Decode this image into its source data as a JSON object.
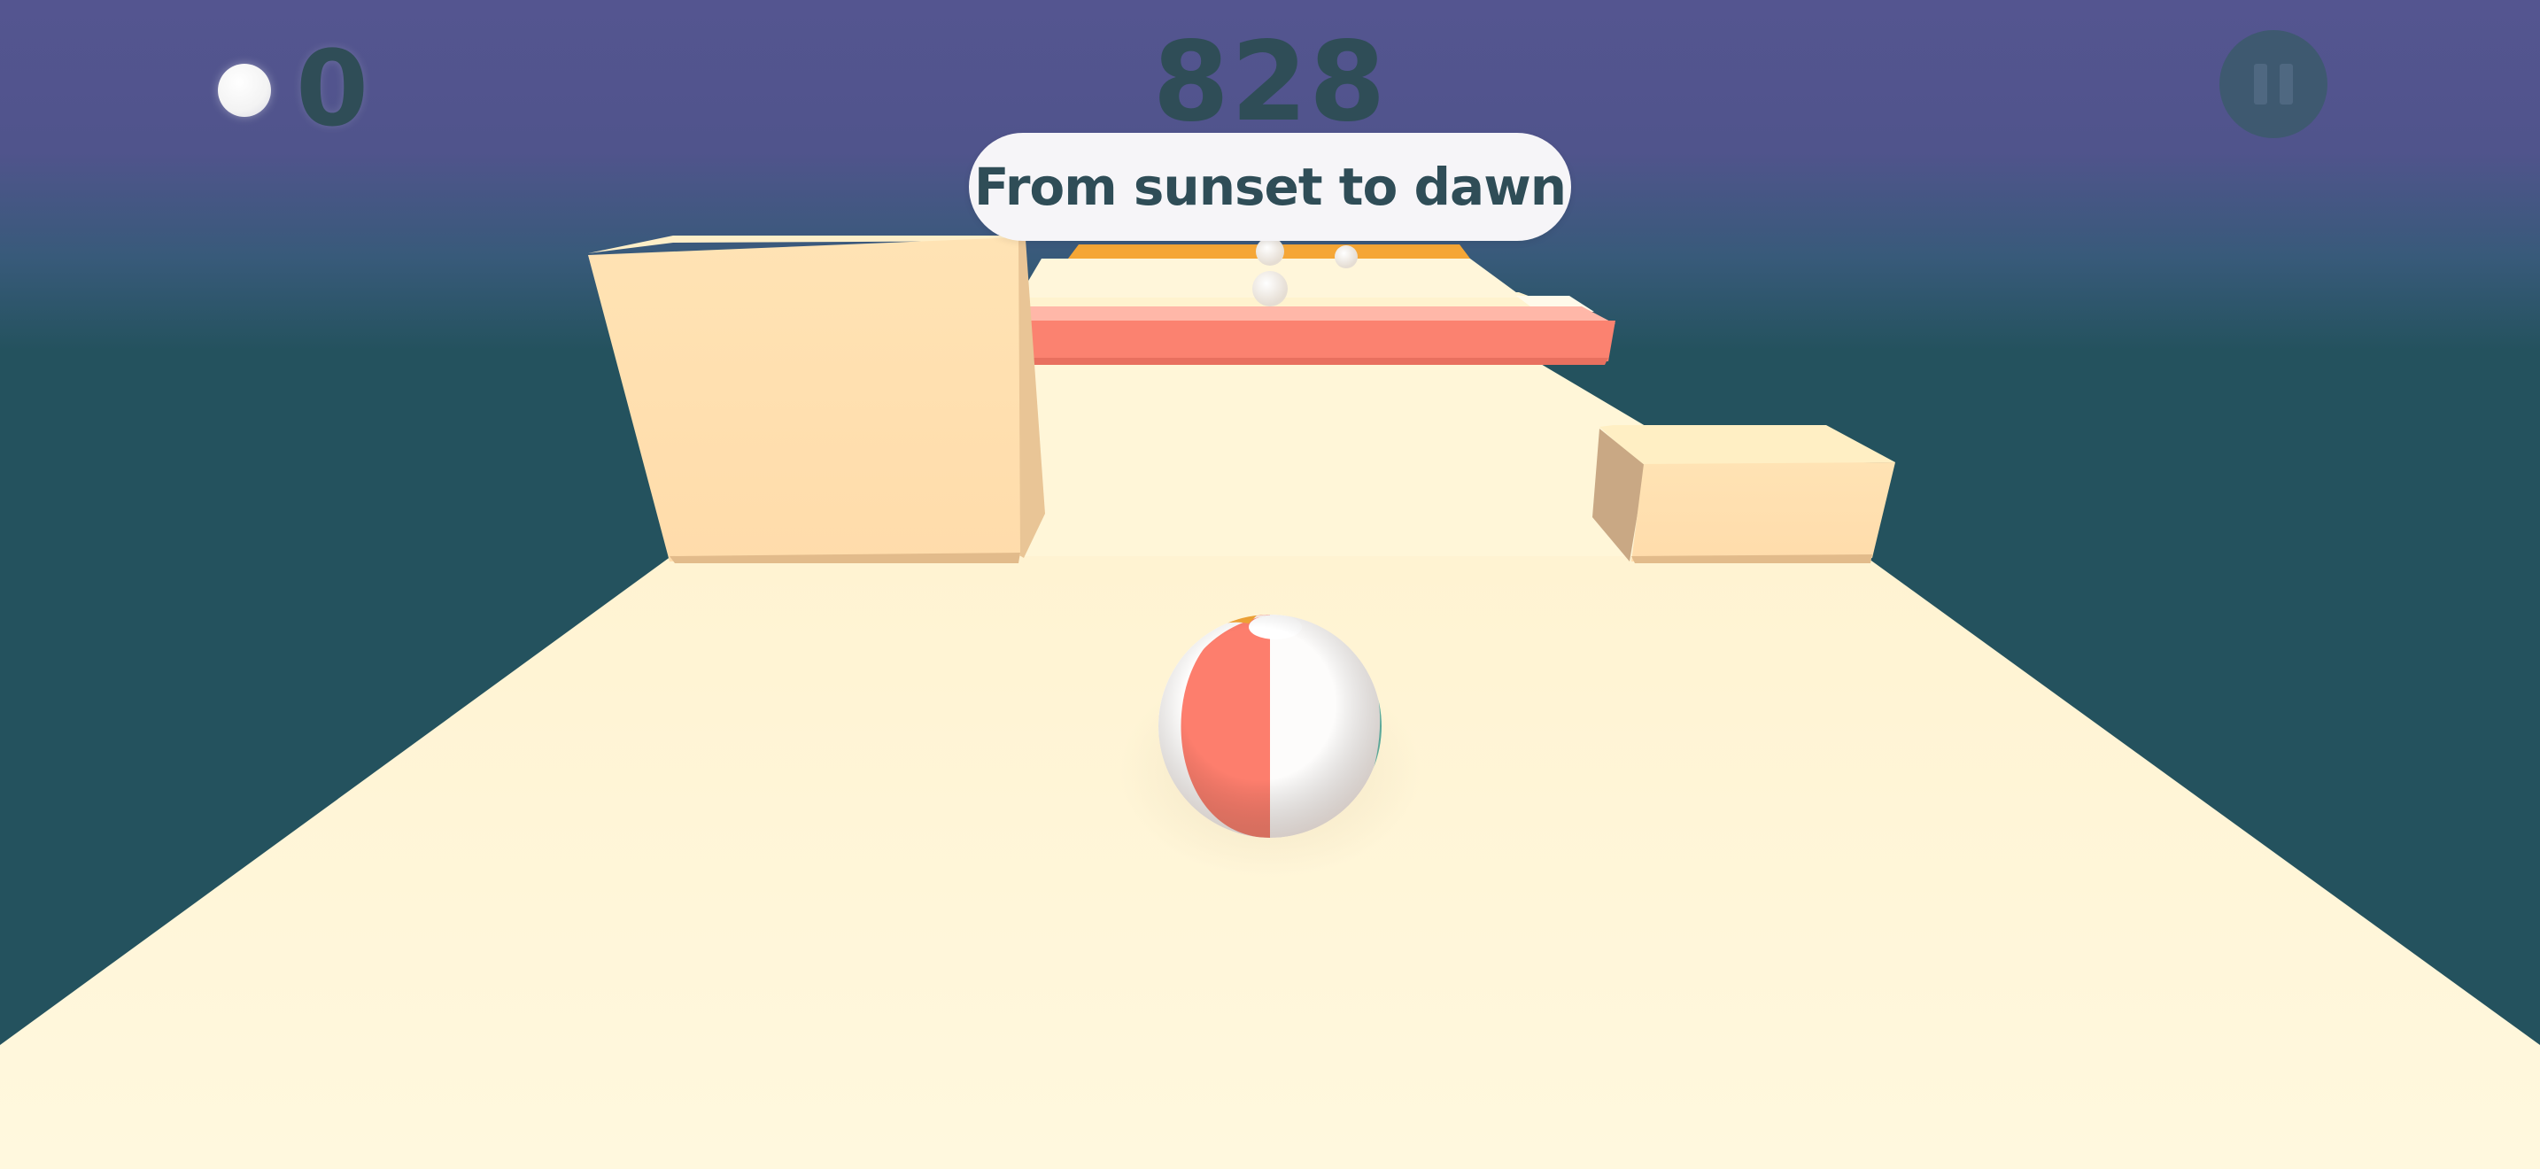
{
  "hud": {
    "coin_count": "0",
    "score": "828",
    "message": "From sunset to dawn",
    "pause_icon": "pause-icon",
    "coin_icon": "coin-icon"
  },
  "colors": {
    "sky_top": "#545590",
    "sky_bottom": "#24525e",
    "track": "#fff8dd",
    "block": "#ffdfae",
    "red_barrier": "#fb8270",
    "orange_strip": "#f5a636",
    "ball_red": "#fd7e6d",
    "ball_teal": "#5ec6b6",
    "ball_white": "#fdfcfb",
    "text_dark": "#2f4d57"
  }
}
